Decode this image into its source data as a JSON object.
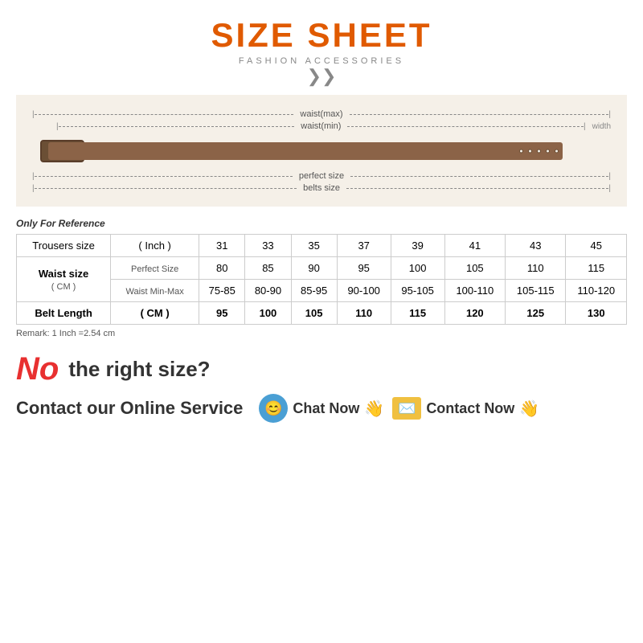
{
  "title": {
    "main": "SIZE SHEET",
    "sub": "FASHION ACCESSORIES"
  },
  "diagram": {
    "measurements": [
      "waist(max)",
      "waist(min)",
      "perfect size",
      "belts size"
    ],
    "width_label": "width"
  },
  "table": {
    "reference_note": "Only For Reference",
    "headers": {
      "col1": "Trousers size",
      "col2": "( Inch )",
      "sizes": [
        "31",
        "33",
        "35",
        "37",
        "39",
        "41",
        "43",
        "45"
      ]
    },
    "waist_label": "Waist size",
    "waist_unit": "( CM )",
    "perfect_size_label": "Perfect Size",
    "waist_minmax_label": "Waist Min-Max",
    "perfect_sizes": [
      "80",
      "85",
      "90",
      "95",
      "100",
      "105",
      "110",
      "115"
    ],
    "minmax_sizes": [
      "75-85",
      "80-90",
      "85-95",
      "90-100",
      "95-105",
      "100-110",
      "105-115",
      "110-120"
    ],
    "belt_length_label": "Belt Length",
    "belt_length_unit": "( CM )",
    "belt_lengths": [
      "95",
      "100",
      "105",
      "110",
      "115",
      "120",
      "125",
      "130"
    ],
    "remark": "Remark: 1 Inch =2.54 cm"
  },
  "bottom": {
    "no_text": "No",
    "right_size_text": "the right size?",
    "contact_label": "Contact our Online Service",
    "chat_button": "Chat Now",
    "contact_button": "Contact Now"
  }
}
